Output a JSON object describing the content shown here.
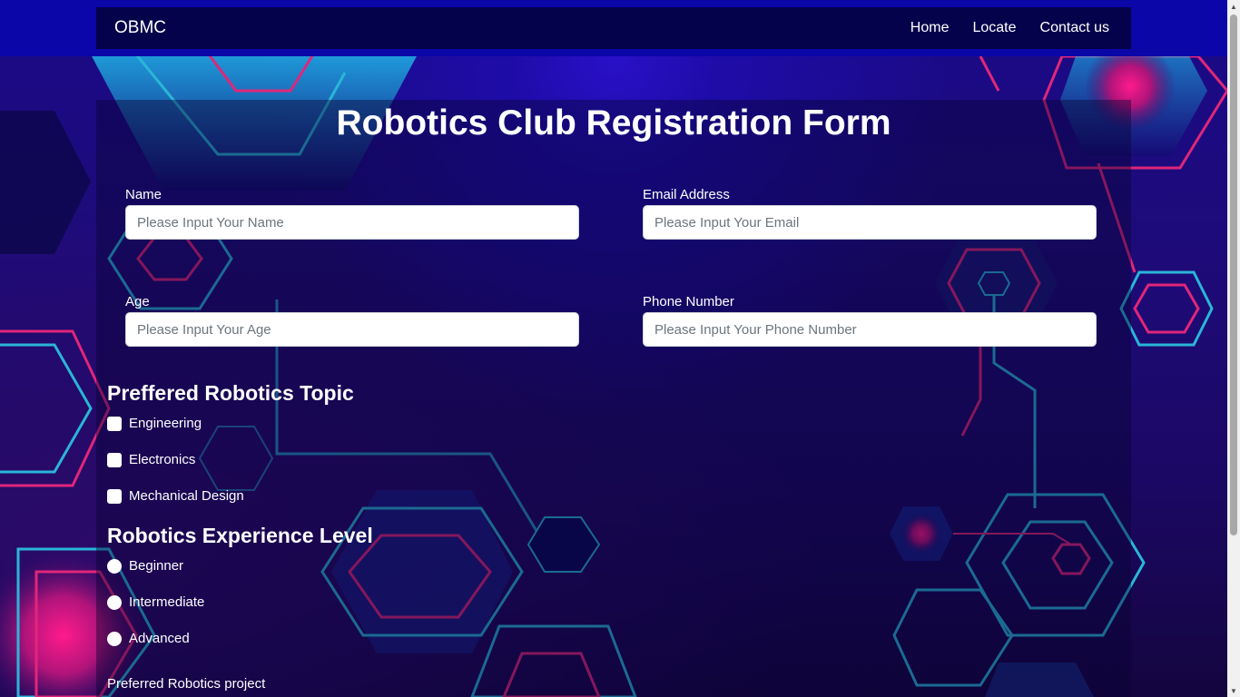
{
  "nav": {
    "brand": "OBMC",
    "links": [
      {
        "label": "Home"
      },
      {
        "label": "Locate"
      },
      {
        "label": "Contact us"
      }
    ]
  },
  "form": {
    "title": "Robotics Club Registration Form",
    "name": {
      "label": "Name",
      "placeholder": "Please Input Your Name",
      "value": ""
    },
    "email": {
      "label": "Email Address",
      "placeholder": "Please Input Your Email",
      "value": ""
    },
    "age": {
      "label": "Age",
      "placeholder": "Please Input Your Age",
      "value": ""
    },
    "phone": {
      "label": "Phone Number",
      "placeholder": "Please Input Your Phone Number",
      "value": ""
    },
    "topics": {
      "heading": "Preffered Robotics Topic",
      "options": [
        {
          "label": "Engineering",
          "checked": false
        },
        {
          "label": "Electronics",
          "checked": false
        },
        {
          "label": "Mechanical Design",
          "checked": false
        }
      ]
    },
    "experience": {
      "heading": "Robotics Experience Level",
      "options": [
        {
          "label": "Beginner",
          "selected": false
        },
        {
          "label": "Intermediate",
          "selected": false
        },
        {
          "label": "Advanced",
          "selected": false
        }
      ]
    },
    "project_label": "Preferred Robotics project"
  },
  "colors": {
    "nav_band": "#0a06a8",
    "navbar": "#04024a",
    "accent_pink": "#e0267a",
    "accent_cyan": "#2ab6d8"
  }
}
